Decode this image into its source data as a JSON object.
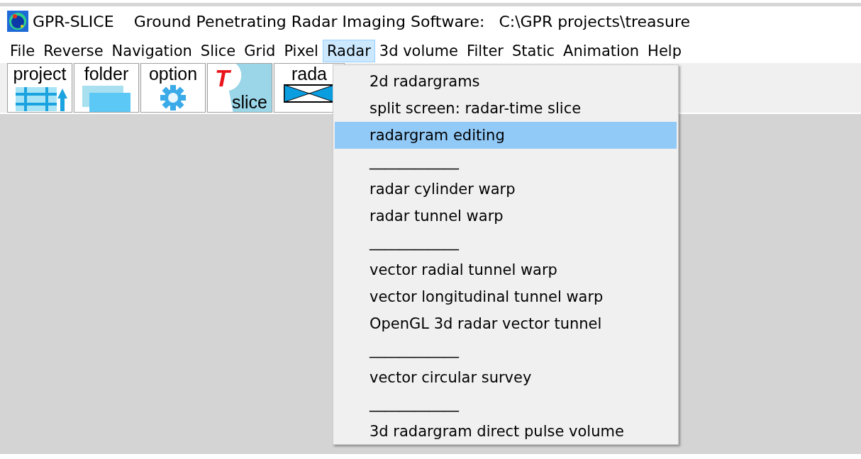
{
  "window": {
    "title": "GPR-SLICE",
    "subtitle": "Ground Penetrating Radar Imaging Software:",
    "path": "C:\\GPR projects\\treasure"
  },
  "menu_bar": [
    {
      "label": "File",
      "selected": false
    },
    {
      "label": "Reverse",
      "selected": false
    },
    {
      "label": "Navigation",
      "selected": false
    },
    {
      "label": "Slice",
      "selected": false
    },
    {
      "label": "Grid",
      "selected": false
    },
    {
      "label": "Pixel",
      "selected": false
    },
    {
      "label": "Radar",
      "selected": true
    },
    {
      "label": "3d volume",
      "selected": false
    },
    {
      "label": "Filter",
      "selected": false
    },
    {
      "label": "Static",
      "selected": false
    },
    {
      "label": "Animation",
      "selected": false
    },
    {
      "label": "Help",
      "selected": false
    }
  ],
  "toolbar": [
    {
      "kind": "project",
      "label": "project"
    },
    {
      "kind": "folder",
      "label": "folder"
    },
    {
      "kind": "option",
      "label": "option"
    },
    {
      "kind": "slice",
      "label": "slice",
      "badge": "T"
    },
    {
      "kind": "radar",
      "label": "rada"
    }
  ],
  "dropdown": [
    {
      "kind": "item",
      "label": "2d radargrams",
      "selected": false
    },
    {
      "kind": "item",
      "label": "split screen: radar-time slice",
      "selected": false
    },
    {
      "kind": "item",
      "label": "radargram editing",
      "selected": true
    },
    {
      "kind": "separator",
      "label": "____________"
    },
    {
      "kind": "item",
      "label": "radar cylinder warp",
      "selected": false
    },
    {
      "kind": "item",
      "label": "radar tunnel warp",
      "selected": false
    },
    {
      "kind": "separator",
      "label": "____________"
    },
    {
      "kind": "item",
      "label": "vector radial tunnel warp",
      "selected": false
    },
    {
      "kind": "item",
      "label": "vector longitudinal tunnel warp",
      "selected": false
    },
    {
      "kind": "item",
      "label": "OpenGL 3d radar vector tunnel",
      "selected": false
    },
    {
      "kind": "separator",
      "label": "____________"
    },
    {
      "kind": "item",
      "label": "vector circular survey",
      "selected": false
    },
    {
      "kind": "separator",
      "label": "____________"
    },
    {
      "kind": "item",
      "label": "3d radargram direct pulse volume",
      "selected": false
    }
  ]
}
